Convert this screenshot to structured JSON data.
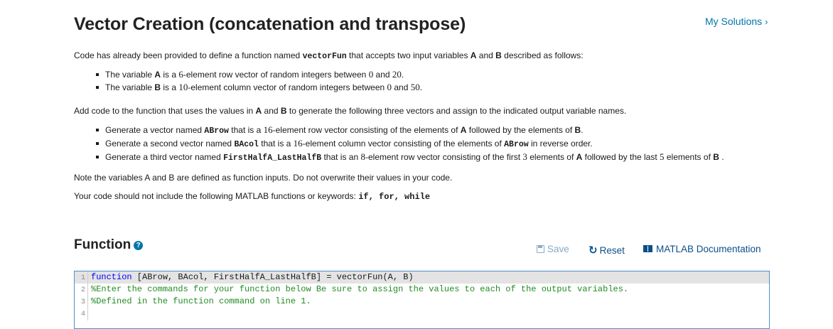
{
  "header": {
    "title": "Vector Creation (concatenation and transpose)",
    "my_solutions": "My Solutions",
    "chevron": "›"
  },
  "description": {
    "p1_prefix": "Code has already been provided to define a function named ",
    "p1_func": "vectorFun",
    "p1_mid": " that accepts two input variables ",
    "p1_A": "A",
    "p1_and": " and ",
    "p1_B": "B",
    "p1_suffix": " described as follows:",
    "bullets1": [
      {
        "pre": "The variable ",
        "var": "A",
        "mid1": " is a ",
        "n": "6",
        "mid2": "-element row vector of random integers between ",
        "lo": "0",
        "and": " and ",
        "hi": "20",
        "end": "."
      },
      {
        "pre": "The variable ",
        "var": "B",
        "mid1": " is a ",
        "n": "10",
        "mid2": "-element column vector of random integers between ",
        "lo": "0",
        "and": " and ",
        "hi": "50",
        "end": "."
      }
    ],
    "p2_prefix": "Add code to the function that uses the values in ",
    "p2_A": "A",
    "p2_and": " and ",
    "p2_B": "B",
    "p2_suffix": " to generate the following three vectors and assign to the indicated output variable names.",
    "b2_1_pre": "Generate a vector named ",
    "b2_1_var": "ABrow",
    "b2_1_mid": " that is a ",
    "b2_1_n": "16",
    "b2_1_mid2": "-element row vector consisting of the elements of ",
    "b2_1_A": "A",
    "b2_1_mid3": " followed by the elements of ",
    "b2_1_B": "B",
    "b2_1_end": ".",
    "b2_2_pre": "Generate a second vector named ",
    "b2_2_var": "BAcol",
    "b2_2_mid": " that is a ",
    "b2_2_n": "16",
    "b2_2_mid2": "-element column vector consisting of the elements of ",
    "b2_2_ref": "ABrow",
    "b2_2_end": " in reverse order.",
    "b2_3_pre": "Generate a third vector named ",
    "b2_3_var": "FirstHalfA_LastHalfB",
    "b2_3_mid": " that is an ",
    "b2_3_n": "8",
    "b2_3_mid2": "-element row vector consisting of the first ",
    "b2_3_k": "3",
    "b2_3_mid3": " elements of ",
    "b2_3_A": "A",
    "b2_3_mid4": " followed by the last ",
    "b2_3_m": "5",
    "b2_3_mid5": " elements of ",
    "b2_3_B": "B",
    "b2_3_end": " .",
    "p3": "Note the variables A and B are defined as function inputs.  Do not overwrite their values in your code.",
    "p4_prefix": "Your code should not include the following MATLAB functions or keywords: ",
    "p4_keywords": "if, for, while"
  },
  "function_section": {
    "heading": "Function",
    "help_icon": "?",
    "save_label": "Save",
    "reset_label": "Reset",
    "reset_icon": "↻",
    "doc_label": "MATLAB Documentation"
  },
  "editor": {
    "lines": [
      {
        "num": "1",
        "kw": "function",
        "text": " [ABrow, BAcol, FirstHalfA_LastHalfB] = vectorFun(A, B)"
      },
      {
        "num": "2",
        "comment": "%Enter the commands for your function below Be sure to assign the values to each of the output variables."
      },
      {
        "num": "3",
        "comment": "%Defined in the function command on line 1."
      },
      {
        "num": "4",
        "text": ""
      }
    ]
  }
}
